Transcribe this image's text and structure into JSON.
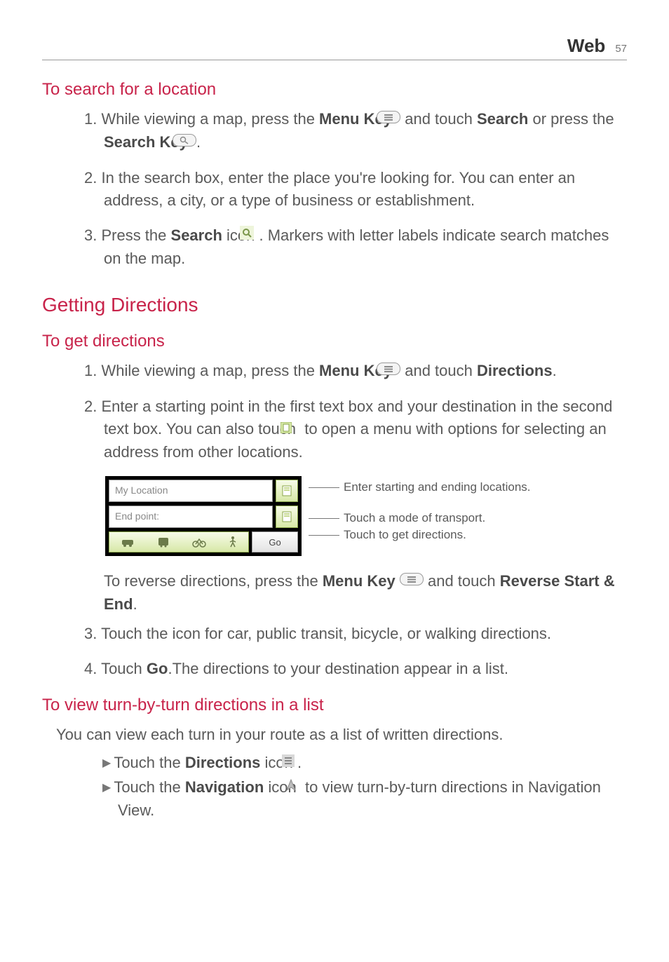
{
  "header": {
    "title": "Web",
    "page": "57"
  },
  "sec_search": {
    "heading": "To search for a location",
    "step1_a": "1. While viewing a map, press the ",
    "step1_b": "Menu Key",
    "step1_c": " and touch ",
    "step1_d": "Search",
    "step1_e": " or press the ",
    "step1_f": "Search Key",
    "step1_g": ".",
    "step2": "2. In the search box, enter the place you're looking for. You can enter an address, a city, or a type of business or establishment.",
    "step3_a": "3. Press the ",
    "step3_b": "Search",
    "step3_c": " icon ",
    "step3_d": ". Markers with letter labels indicate search matches on the map."
  },
  "sec_getdir_h1": "Getting Directions",
  "sec_getdir": {
    "heading": "To get directions",
    "step1_a": "1. While viewing a map, press the ",
    "step1_b": "Menu Key",
    "step1_c": " and touch ",
    "step1_d": "Directions",
    "step1_e": ".",
    "step2_a": "2. Enter a starting point in the first text box and your destination in the second text box. You can also touch ",
    "step2_b": " to open a menu with options for selecting an address from other locations.",
    "reverse_a": "To reverse directions, press the ",
    "reverse_b": "Menu Key",
    "reverse_c": " and touch ",
    "reverse_d": "Reverse Start & End",
    "reverse_e": ".",
    "step3": "3. Touch the icon for car, public transit, bicycle, or walking directions.",
    "step4_a": "4. Touch ",
    "step4_b": "Go",
    "step4_c": ".The directions to your destination appear in a list."
  },
  "phone_ui": {
    "field1": "My Location",
    "field2": "End point:",
    "go": "Go",
    "callout1": "Enter starting and ending locations.",
    "callout2": "Touch a mode of transport.",
    "callout3": "Touch to get directions."
  },
  "sec_turn": {
    "heading": "To view turn-by-turn directions in a list",
    "intro": "You can view each turn in your route as a list of written directions.",
    "b1_a": "Touch the ",
    "b1_b": "Directions",
    "b1_c": " icon ",
    "b1_d": ".",
    "b2_a": "Touch the ",
    "b2_b": "Navigation",
    "b2_c": " icon ",
    "b2_d": " to view turn-by-turn directions in Navigation View."
  }
}
